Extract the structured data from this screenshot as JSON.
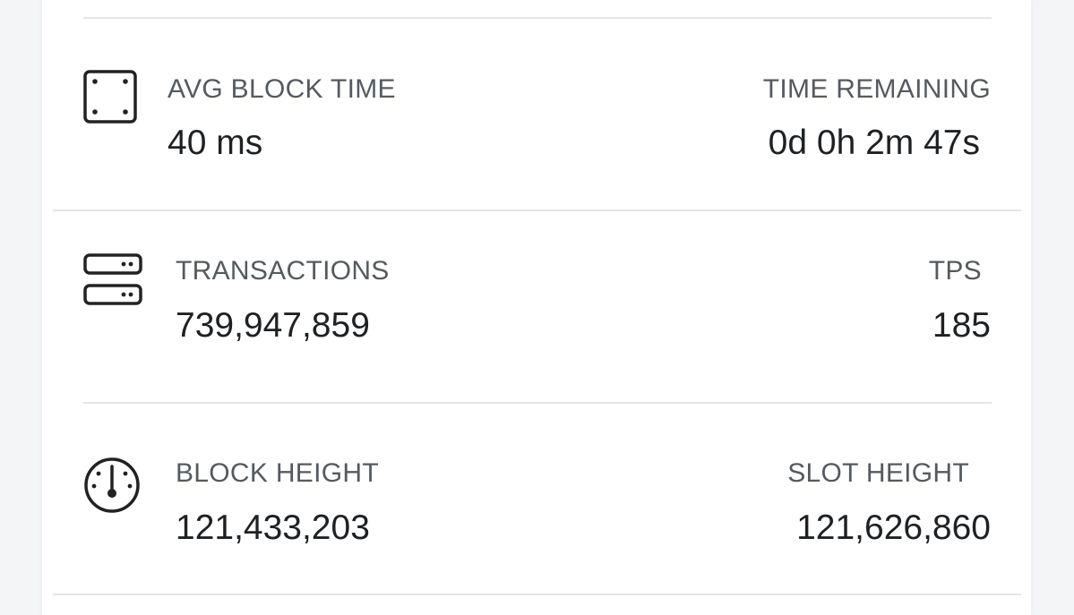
{
  "stats": [
    {
      "icon": "square-dots-icon",
      "left_label": "AVG BLOCK TIME",
      "left_value": "40 ms",
      "right_label": "TIME REMAINING",
      "right_value": "0d 0h 2m 47s"
    },
    {
      "icon": "server-icon",
      "left_label": "TRANSACTIONS",
      "left_value": "739,947,859",
      "right_label": "TPS",
      "right_value": "185"
    },
    {
      "icon": "gauge-icon",
      "left_label": "BLOCK HEIGHT",
      "left_value": "121,433,203",
      "right_label": "SLOT HEIGHT",
      "right_value": "121,626,860"
    }
  ]
}
